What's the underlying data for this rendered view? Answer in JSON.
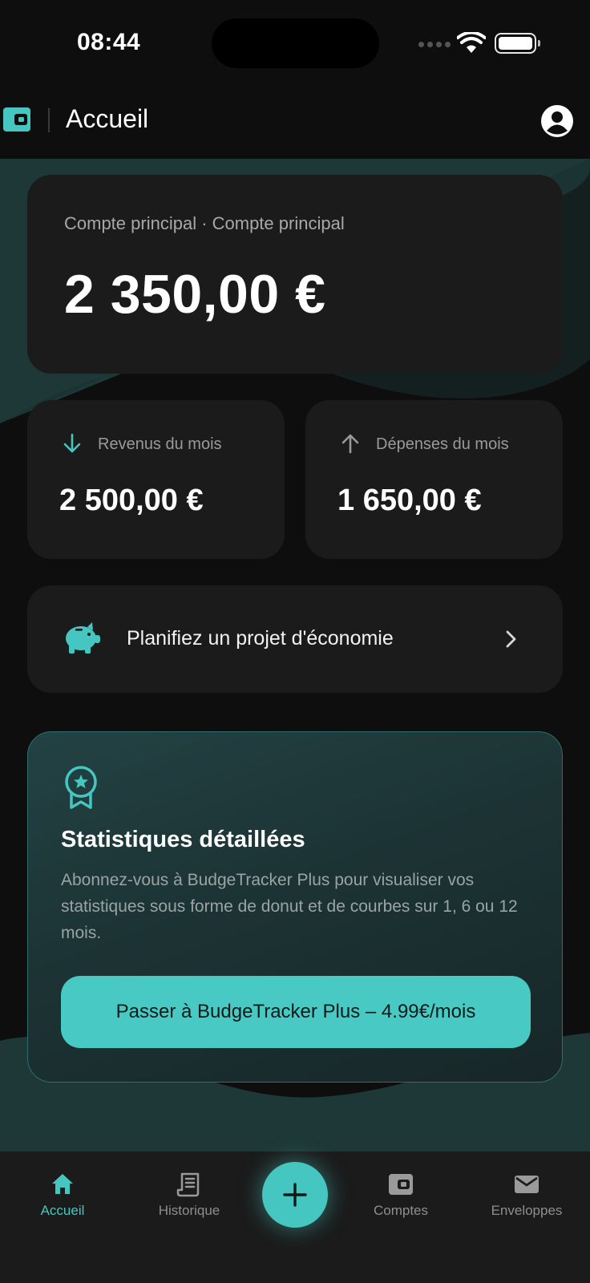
{
  "status_bar": {
    "time": "08:44"
  },
  "header": {
    "title": "Accueil",
    "logo_icon": "wallet-icon",
    "profile_icon": "account-circle-icon"
  },
  "main_account": {
    "label": "Compte principal · Compte principal",
    "balance": "2 350,00 €"
  },
  "income": {
    "label": "Revenus du mois",
    "value": "2 500,00 €",
    "icon": "arrow-down-icon"
  },
  "expense": {
    "label": "Dépenses du mois",
    "value": "1 650,00 €",
    "icon": "arrow-up-icon"
  },
  "savings_plan": {
    "label": "Planifiez un projet d'économie",
    "icon": "piggy-bank-icon"
  },
  "promo": {
    "icon": "award-icon",
    "title": "Statistiques détaillées",
    "description": "Abonnez-vous à BudgeTracker Plus pour visualiser vos statistiques sous forme de donut et de courbes sur 1, 6 ou 12 mois.",
    "cta_label": "Passer à BudgeTracker Plus – 4.99€/mois"
  },
  "nav": {
    "items": [
      {
        "label": "Accueil",
        "icon": "home-icon",
        "active": true
      },
      {
        "label": "Historique",
        "icon": "receipt-icon",
        "active": false
      },
      {
        "label": "Comptes",
        "icon": "wallet-icon",
        "active": false
      },
      {
        "label": "Enveloppes",
        "icon": "envelope-icon",
        "active": false
      }
    ],
    "add_icon": "plus-icon"
  },
  "colors": {
    "accent": "#46c6c0",
    "background": "#0e0e0e",
    "card": "#1b1b1b"
  }
}
